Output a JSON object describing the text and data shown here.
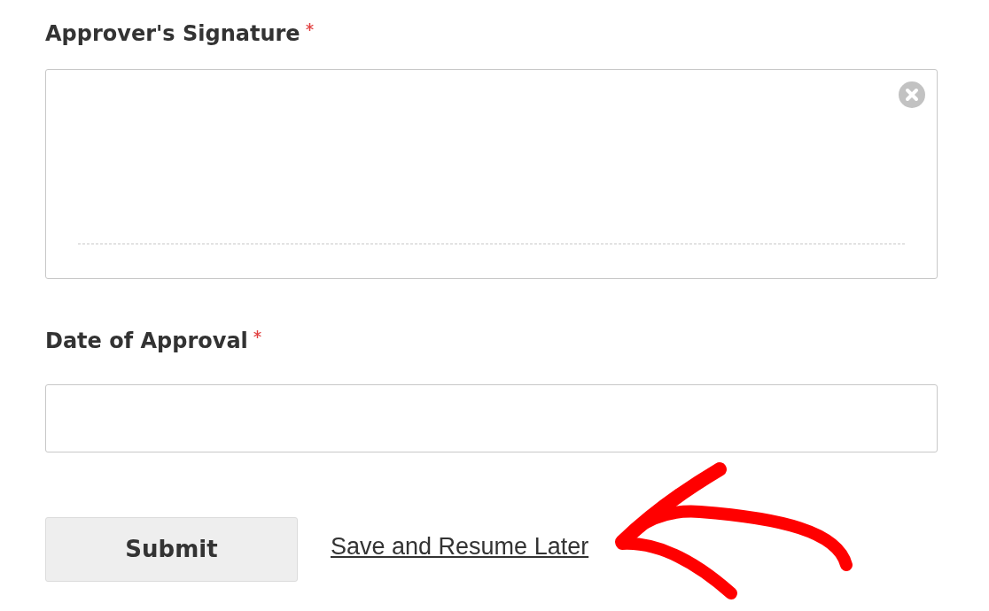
{
  "fields": [
    {
      "kind": "signature",
      "label": "Approver's Signature",
      "required": true
    },
    {
      "kind": "text",
      "label": "Date of Approval",
      "required": true
    }
  ],
  "submit_button": "Submit",
  "save_link": "Save and Resume Later",
  "annotation": {
    "kind": "arrow"
  }
}
